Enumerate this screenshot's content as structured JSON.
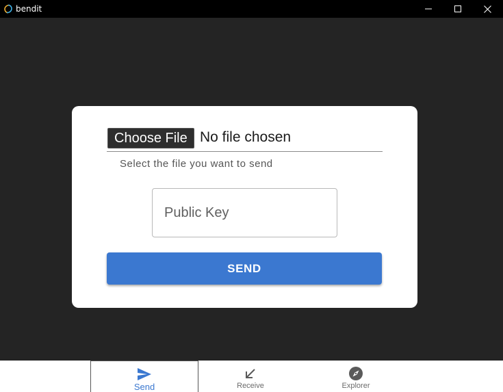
{
  "window": {
    "title": "bendit",
    "logo_icon": "bendit-logo-icon",
    "controls": [
      "minimize-icon",
      "maximize-icon",
      "close-icon"
    ]
  },
  "send_form": {
    "choose_file_label": "Choose File",
    "file_status": "No file chosen",
    "file_helper": "Select the file you want to send",
    "public_key_placeholder": "Public Key",
    "public_key_value": "",
    "send_label": "SEND"
  },
  "bottom_nav": {
    "active": "Send",
    "active_color": "#3b78d0",
    "items": [
      {
        "label": "Send",
        "icon": "send-icon"
      },
      {
        "label": "Receive",
        "icon": "arrow-down-left-icon"
      },
      {
        "label": "Explorer",
        "icon": "compass-icon"
      }
    ]
  }
}
